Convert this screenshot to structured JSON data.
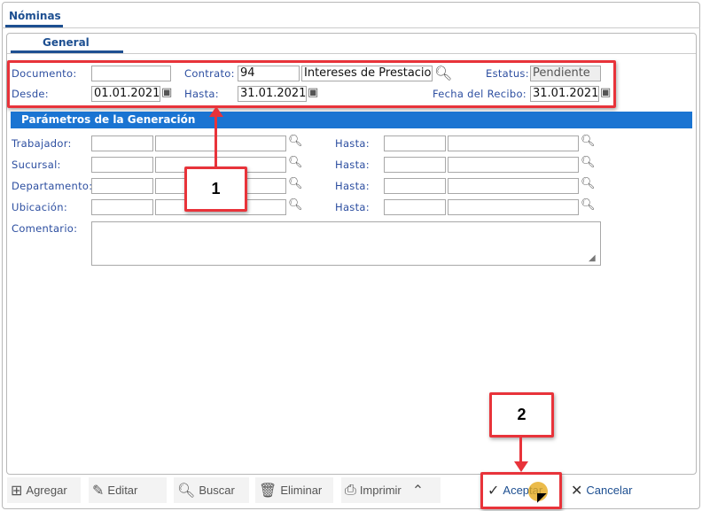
{
  "window": {
    "tab": "Nóminas",
    "subtab": "General"
  },
  "header": {
    "documento": {
      "label": "Documento:",
      "value": ""
    },
    "contrato": {
      "label": "Contrato:",
      "code": "94",
      "description": "Intereses de Prestacio"
    },
    "estatus": {
      "label": "Estatus:",
      "value": "Pendiente"
    },
    "desde": {
      "label": "Desde:",
      "value": "01.01.2021"
    },
    "hasta": {
      "label": "Hasta:",
      "value": "31.01.2021"
    },
    "fecha_recibo": {
      "label": "Fecha del Recibo:",
      "value": "31.01.2021"
    }
  },
  "params": {
    "title": "Parámetros de la Generación",
    "hasta_label": "Hasta:",
    "rows": [
      {
        "label": "Trabajador:"
      },
      {
        "label": "Sucursal:"
      },
      {
        "label": "Departamento:"
      },
      {
        "label": "Ubicación:"
      }
    ],
    "comentario": {
      "label": "Comentario:",
      "value": ""
    }
  },
  "callouts": [
    "1",
    "2"
  ],
  "toolbar": {
    "agregar": "Agregar",
    "editar": "Editar",
    "buscar": "Buscar",
    "eliminar": "Eliminar",
    "imprimir": "Imprimir",
    "aceptar": "Aceptar",
    "cancelar": "Cancelar"
  },
  "colors": {
    "accent": "#1a74d2",
    "highlight": "#e8333a",
    "label": "#2c4ea0"
  }
}
